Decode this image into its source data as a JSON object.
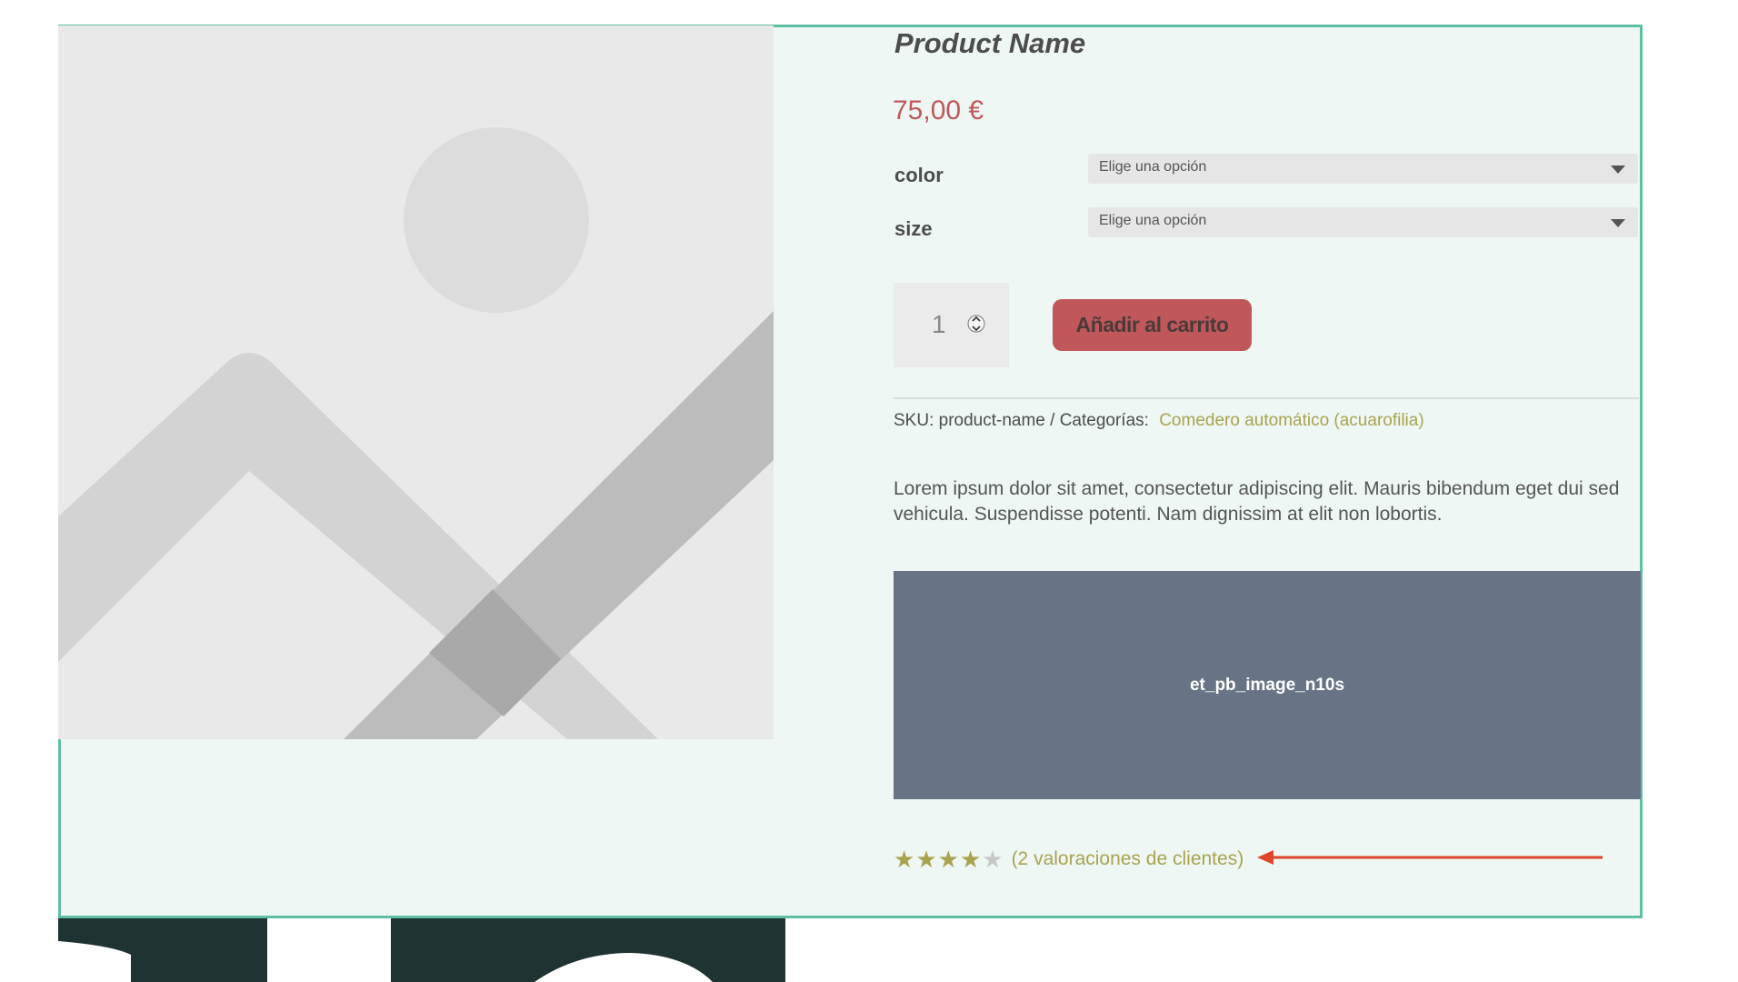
{
  "product": {
    "title": "Product Name",
    "price": "75,00 €",
    "attributes": [
      {
        "label": "color",
        "placeholder": "Elige una opción"
      },
      {
        "label": "size",
        "placeholder": "Elige una opción"
      }
    ],
    "quantity": "1",
    "add_to_cart": "Añadir al carrito",
    "sku_line": "SKU: product-name / Categorías:",
    "category_link": "Comedero automático (acuarofilia)",
    "description": "Lorem ipsum dolor sit amet, consectetur adipiscing elit. Mauris bibendum eget dui sed vehicula. Suspendisse potenti. Nam dignissim at elit non lobortis.",
    "module_label": "et_pb_image_n10s",
    "rating": {
      "value": 4,
      "max": 5,
      "reviews_text": "(2 valoraciones de clientes)"
    }
  },
  "colors": {
    "frame_border": "#5fbfa5",
    "background": "#eef7f3",
    "accent_red": "#c0585b",
    "accent_olive": "#a9a350",
    "module_bg": "#687485",
    "arrow": "#e0452c"
  },
  "icons": {
    "placeholder_image": "image-placeholder-icon",
    "select_chevron": "chevron-down-icon",
    "qty_spinner": "stepper-icon",
    "star": "star-icon",
    "arrow": "arrow-left-icon"
  }
}
